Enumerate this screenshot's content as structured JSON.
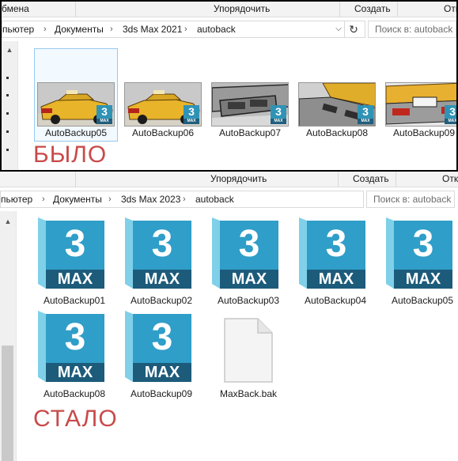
{
  "before": {
    "ribbon": {
      "left": "бмена",
      "organize": "Упорядочить",
      "create": "Создать",
      "open": "Отк"
    },
    "breadcrumb": [
      "пьютер",
      "Документы",
      "3ds Max 2021",
      "autoback"
    ],
    "search": {
      "placeholder": "Поиск в: autoback"
    },
    "files": [
      {
        "name": "AutoBackup05",
        "thumb": "taxi-car-thumbnail"
      },
      {
        "name": "AutoBackup06",
        "thumb": "taxi-car-thumbnail"
      },
      {
        "name": "AutoBackup07",
        "thumb": "car-rear-thumbnail"
      },
      {
        "name": "AutoBackup08",
        "thumb": "car-rear-thumbnail"
      },
      {
        "name": "AutoBackup09",
        "thumb": "car-rear-thumbnail"
      }
    ],
    "caption": "БЫЛО"
  },
  "after": {
    "ribbon": {
      "organize": "Упорядочить",
      "create": "Создать",
      "open": "Отк"
    },
    "breadcrumb": [
      "пьютер",
      "Документы",
      "3ds Max 2023",
      "autoback"
    ],
    "search": {
      "placeholder": "Поиск в: autoback"
    },
    "icon": {
      "number": "3",
      "word": "MAX"
    },
    "files": [
      {
        "name": "AutoBackup01"
      },
      {
        "name": "AutoBackup02"
      },
      {
        "name": "AutoBackup03"
      },
      {
        "name": "AutoBackup04"
      },
      {
        "name": "AutoBackup05"
      },
      {
        "name": "AutoBackup08"
      },
      {
        "name": "AutoBackup09"
      },
      {
        "name": "MaxBack.bak"
      }
    ],
    "caption": "СТАЛО"
  },
  "thumb_badge": {
    "number": "3",
    "word": "MAX"
  },
  "colors": {
    "icon_light": "#3ab4d7",
    "icon_dark": "#2182a7",
    "icon_band": "#1d5b7b",
    "caption": "#c84a4a"
  }
}
